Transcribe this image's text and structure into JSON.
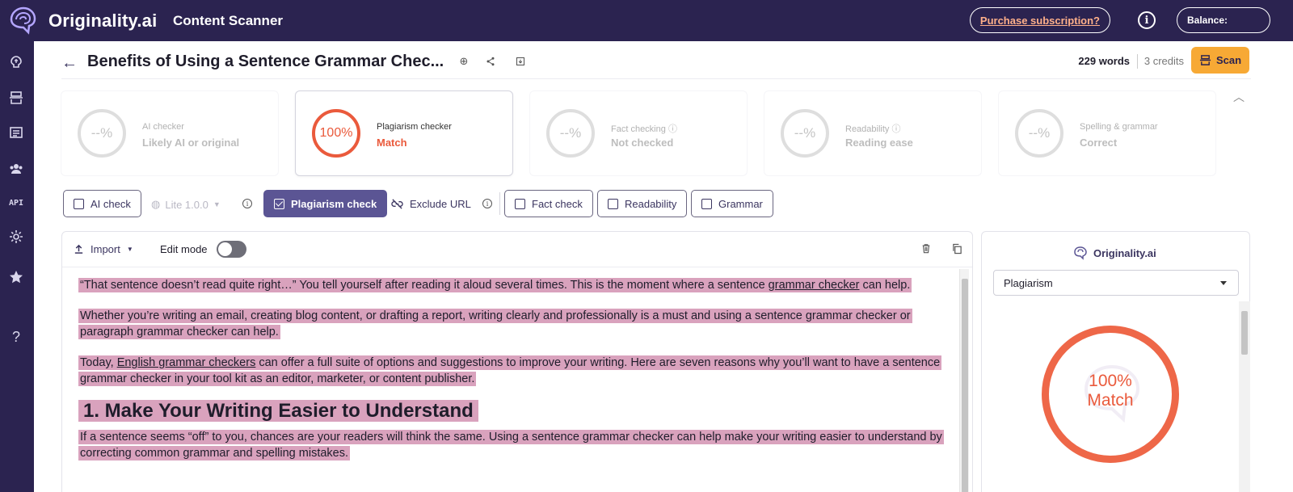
{
  "brand": {
    "name": "Originality.ai",
    "app_title": "Content Scanner"
  },
  "topbar": {
    "purchase_label": "Purchase subscription?",
    "info_label": "i",
    "balance_label": "Balance:"
  },
  "sidebar": {
    "items": [
      {
        "icon": "brain-icon"
      },
      {
        "icon": "scanner-icon"
      },
      {
        "icon": "library-icon"
      },
      {
        "icon": "team-icon"
      },
      {
        "icon": "api-icon",
        "label": "API"
      },
      {
        "icon": "gear-icon"
      },
      {
        "icon": "star-icon"
      },
      {
        "icon": "help-icon",
        "label": "?"
      }
    ]
  },
  "document": {
    "title": "Benefits of Using a Sentence Grammar Chec...",
    "words": "229 words",
    "credits": "3 credits",
    "scan_label": "Scan"
  },
  "cards": [
    {
      "ring": "--%",
      "label": "AI checker",
      "value": "Likely AI or original",
      "active": false
    },
    {
      "ring": "100%",
      "label": "Plagiarism checker",
      "value": "Match",
      "active": true
    },
    {
      "ring": "--%",
      "label": "Fact checking",
      "value": "Not checked",
      "active": false
    },
    {
      "ring": "--%",
      "label": "Readability",
      "value": "Reading ease",
      "active": false
    },
    {
      "ring": "--%",
      "label": "Spelling & grammar",
      "value": "Correct",
      "active": false
    }
  ],
  "toggles": {
    "ai_check": "AI check",
    "lite_version": "Lite 1.0.0",
    "plagiarism_check": "Plagiarism check",
    "exclude_url": "Exclude URL",
    "fact_check": "Fact check",
    "readability": "Readability",
    "grammar": "Grammar"
  },
  "editor": {
    "import_label": "Import",
    "edit_mode_label": "Edit mode",
    "edit_mode_on": false,
    "p1": "“That sentence doesn’t read quite right…” You tell yourself after reading it aloud several times.   This is the moment where a sentence ",
    "p1_link": "grammar checker",
    "p1_end": " can help.",
    "p2": "Whether you’re writing an email, creating blog content, or drafting a report, writing clearly and professionally is a must and using a sentence grammar checker or paragraph grammar checker can help.",
    "p3_start": "Today, ",
    "p3_link": "English grammar checkers",
    "p3_end": " can offer a full suite of options and suggestions to improve your writing.   Here are seven reasons why you’ll want to have a sentence grammar checker in your tool kit as an editor, marketer, or content publisher.",
    "h1": "1.   Make Your Writing Easier to Understand",
    "p4": "If a sentence seems “off” to you, chances are your readers will think the same.   Using a sentence grammar checker can help make your writing easier to understand by correcting common grammar and spelling mistakes."
  },
  "result_panel": {
    "brand": "Originality.ai",
    "select_value": "Plagiarism",
    "score": "100%",
    "score_label": "Match"
  },
  "colors": {
    "nav_bg": "#2b2350",
    "accent": "#5b5594",
    "match_red": "#ea5a3c",
    "highlight": "#d9a2bd",
    "scan_yellow": "#f7a935"
  }
}
